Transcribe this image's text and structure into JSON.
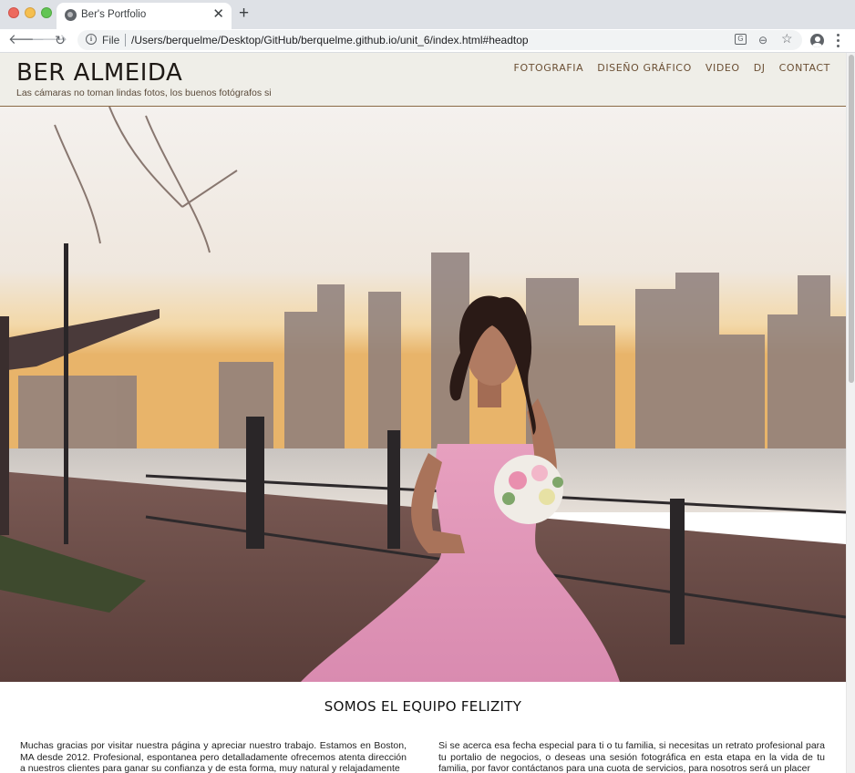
{
  "browser": {
    "tab_title": "Ber's Portfolio",
    "tab_close": "✕",
    "new_tab": "+",
    "file_label": "File",
    "url": "/Users/berquelme/Desktop/GitHub/berquelme.github.io/unit_6/index.html#headtop",
    "icons": [
      "globe-icon",
      "back-icon",
      "forward-icon",
      "reload-icon",
      "info-icon",
      "translate-icon",
      "zoom-icon",
      "star-icon",
      "account-icon",
      "menu-icon"
    ]
  },
  "site": {
    "brand": "BER ALMEIDA",
    "tagline": "Las cámaras no toman lindas fotos, los buenos fotógrafos si",
    "nav": {
      "fotografia": "FOTOGRAFIA",
      "diseno": "DISEÑO GRÁFICO",
      "video": "VIDEO",
      "dj": "DJ",
      "contact": "CONTACT"
    },
    "section_title": "SOMOS EL EQUIPO FELIZITY",
    "col_left": "Muchas gracias por visitar nuestra página y apreciar nuestro trabajo. Estamos en Boston, MA desde 2012. Profesional, espontanea pero detalladamente ofrecemos atenta dirección a nuestros clientes para ganar su confianza y de esta forma, muy natural y relajadamente",
    "col_right": "Si se acerca esa fecha especial para ti o tu familia, si necesitas un retrato profesional para tu portalio de negocios, o deseas una sesión fotográfica en esta etapa en la vida de tu familia, por favor contáctanos para una cuota de servicios, para nosotros será un placer"
  },
  "colors": {
    "header_bg": "#efeee8",
    "header_rule": "#8a6a45",
    "nav_text": "#6b4f34",
    "dress_pink": "#e9a6c2"
  }
}
